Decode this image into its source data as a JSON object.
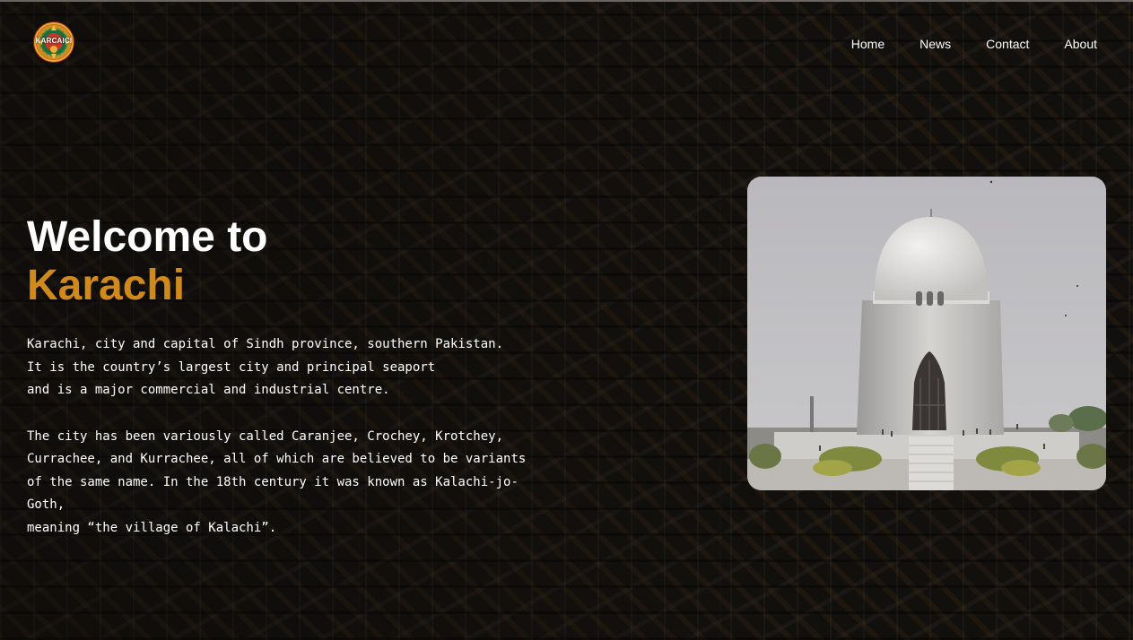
{
  "nav": {
    "logo_text": "KARCAICI",
    "items": [
      "Home",
      "News",
      "Contact",
      "About"
    ]
  },
  "hero": {
    "title_line1": "Welcome to",
    "title_line2": "Karachi",
    "paragraph1": [
      "Karachi, city and capital of Sindh province, southern Pakistan.",
      "It is the country’s largest city and principal seaport",
      "and is a major commercial and industrial centre."
    ],
    "paragraph2": [
      "The city has been variously called Caranjee, Crochey, Krotchey,",
      "Currachee, and Kurrachee, all of which are believed to be variants",
      "of the same name. In the 18th century it was known as Kalachi-jo-",
      "Goth,",
      "meaning “the village of Kalachi”."
    ]
  },
  "colors": {
    "accent": "#d08a1c",
    "text": "#ffffff"
  },
  "image": {
    "subject": "mazar-e-quaid-monument"
  }
}
